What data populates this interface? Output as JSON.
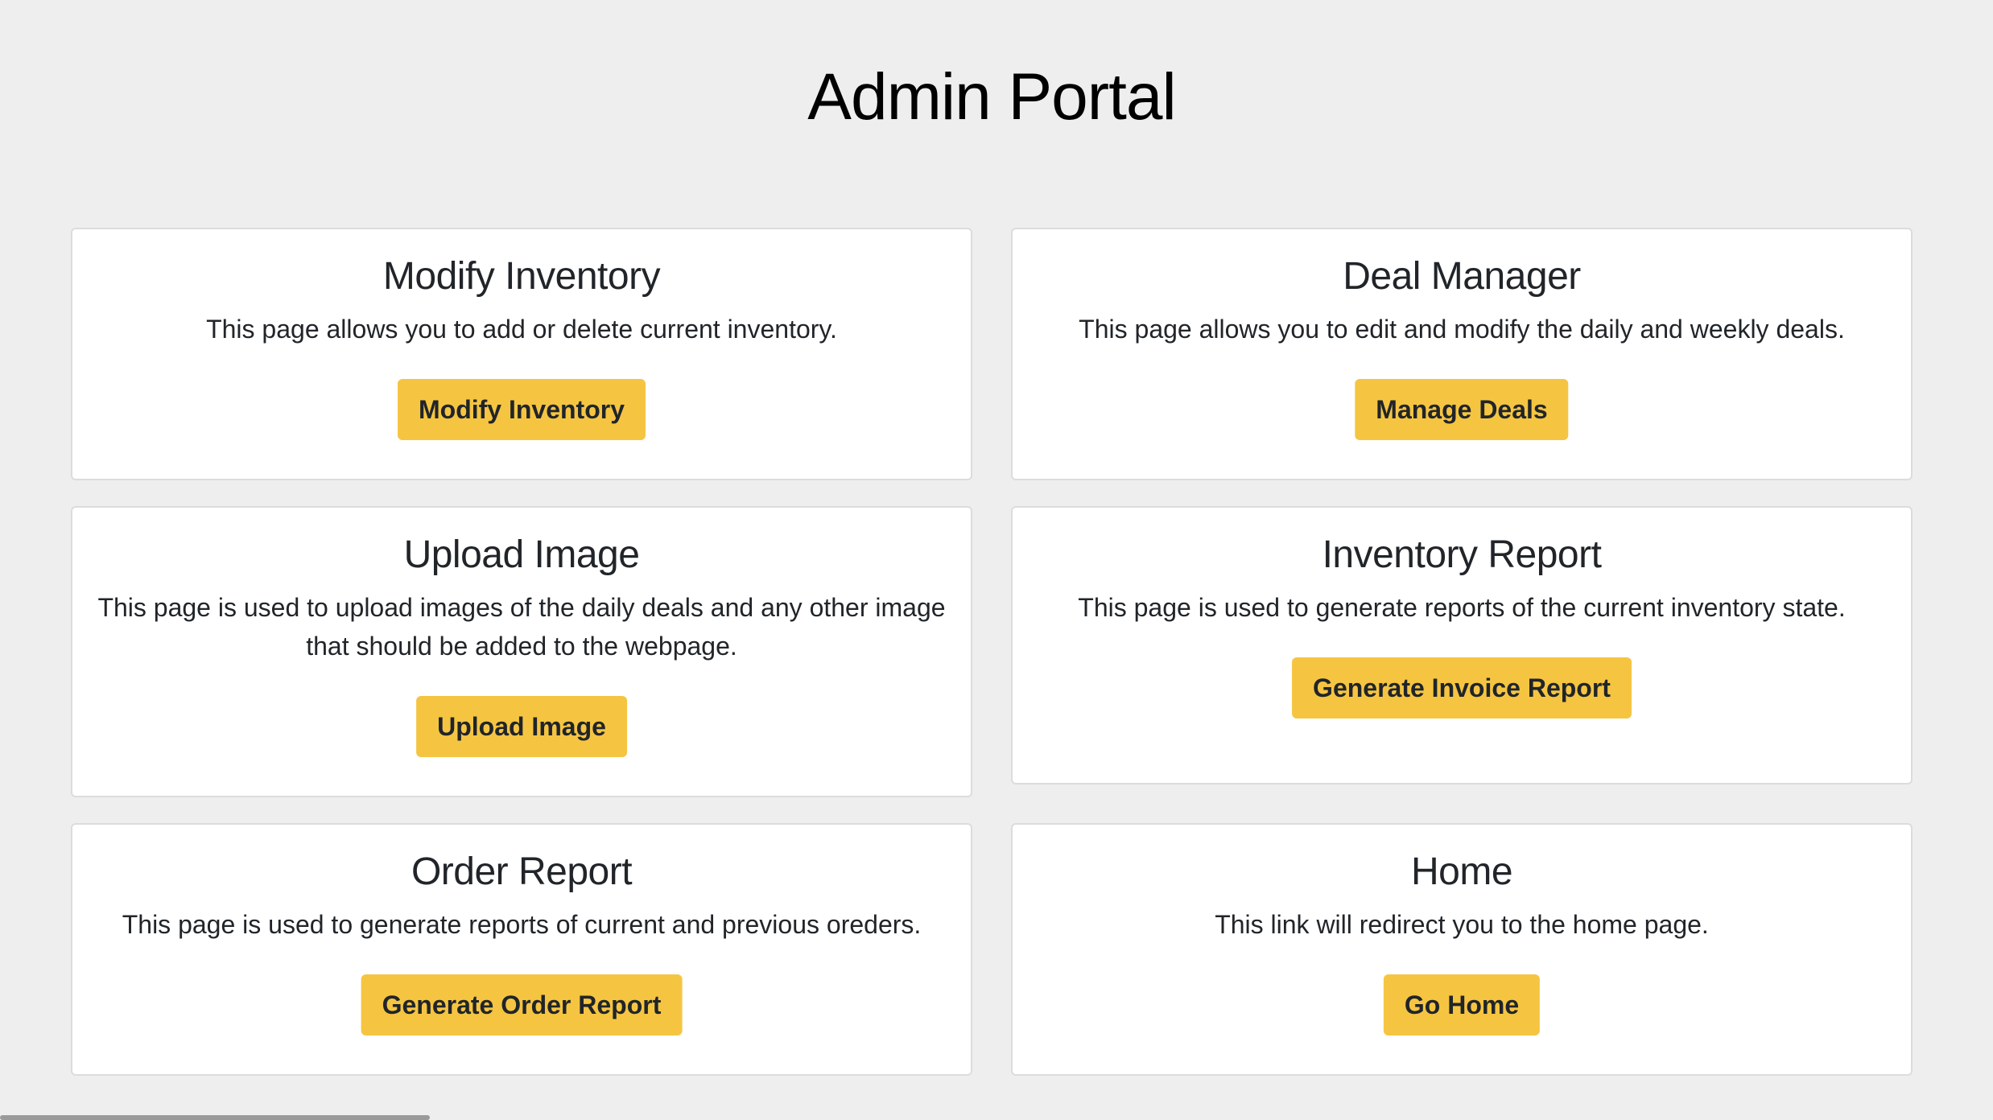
{
  "page": {
    "title": "Admin Portal"
  },
  "cards": [
    {
      "title": "Modify Inventory",
      "text": "This page allows you to add or delete current inventory.",
      "button": "Modify Inventory"
    },
    {
      "title": "Deal Manager",
      "text": "This page allows you to edit and modify the daily and weekly deals.",
      "button": "Manage Deals"
    },
    {
      "title": "Upload Image",
      "text": "This page is used to upload images of the daily deals and any other image that should be added to the webpage.",
      "button": "Upload Image"
    },
    {
      "title": "Inventory Report",
      "text": "This page is used to generate reports of the current inventory state.",
      "button": "Generate Invoice Report"
    },
    {
      "title": "Order Report",
      "text": "This page is used to generate reports of current and previous oreders.",
      "button": "Generate Order Report"
    },
    {
      "title": "Home",
      "text": "This link will redirect you to the home page.",
      "button": "Go Home"
    }
  ],
  "colors": {
    "background": "#eeeeee",
    "card": "#ffffff",
    "button": "#f5c542",
    "text": "#212529"
  }
}
